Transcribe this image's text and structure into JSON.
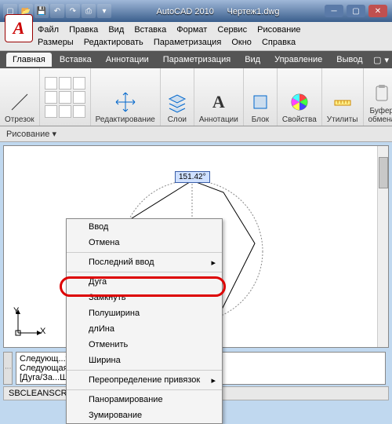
{
  "titlebar": {
    "app": "AutoCAD 2010",
    "doc": "Чертеж1.dwg"
  },
  "qat": [
    "new",
    "open",
    "save",
    "undo",
    "redo",
    "print",
    "more"
  ],
  "classic_menu": {
    "row1": [
      "Файл",
      "Правка",
      "Вид",
      "Вставка",
      "Формат",
      "Сервис",
      "Рисование"
    ],
    "row2": [
      "Размеры",
      "Редактировать",
      "Параметризация",
      "Окно",
      "Справка"
    ]
  },
  "ribbon_tabs": [
    "Главная",
    "Вставка",
    "Аннотации",
    "Параметризация",
    "Вид",
    "Управление",
    "Вывод"
  ],
  "ribbon_active": 0,
  "ribbon_panels": [
    {
      "label": "Отрезок",
      "icon": "line"
    },
    {
      "label": "Редактирование",
      "icon": "move"
    },
    {
      "label": "Слои",
      "icon": "layers"
    },
    {
      "label": "Аннотации",
      "icon": "A"
    },
    {
      "label": "Блок",
      "icon": "block"
    },
    {
      "label": "Свойства",
      "icon": "circle"
    },
    {
      "label": "Утилиты",
      "icon": "measure"
    },
    {
      "label": "Буфер\nобмена",
      "icon": "clipboard"
    }
  ],
  "draw_combo": "Рисование ▾",
  "angle": "151.42°",
  "ucs": {
    "y": "Y",
    "x": "X"
  },
  "ctx_menu": [
    {
      "label": "Ввод"
    },
    {
      "label": "Отмена"
    },
    {
      "label": "Последний ввод",
      "sub": true,
      "sep": true
    },
    {
      "label": "Дуга",
      "sep": true
    },
    {
      "label": "Замкнуть"
    },
    {
      "label": "Полуширина"
    },
    {
      "label": "длИна"
    },
    {
      "label": "Отменить"
    },
    {
      "label": "Ширина"
    },
    {
      "label": "Переопределение привязок",
      "sub": true,
      "sep": true
    },
    {
      "label": "Панорамирование",
      "sep": true
    },
    {
      "label": "Зумирование"
    }
  ],
  "cmd": {
    "row1": "Следующ...уширина/длИна/Отменить/Ширина]:",
    "row2": "Следующая",
    "row3": "[Дуга/За...Ширине]:",
    "side_ctrl": "⋮"
  },
  "status": [
    "SBCLEANSCR",
    "",
    ""
  ]
}
